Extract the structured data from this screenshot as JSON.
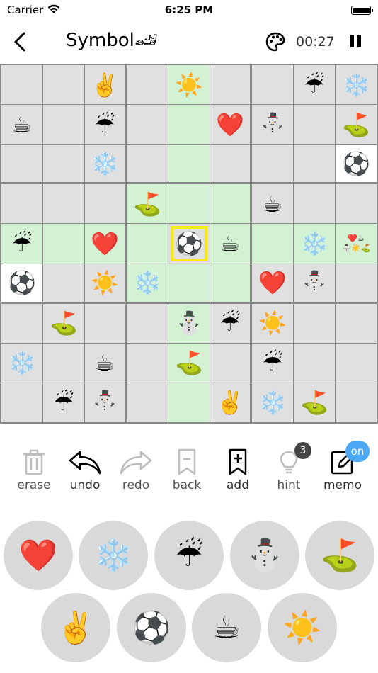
{
  "status": {
    "carrier": "Carrier",
    "time": "6:25 PM"
  },
  "nav": {
    "title": "Symbol🏎",
    "timer": "00:27"
  },
  "board": {
    "rows": [
      [
        "",
        "",
        "✌️",
        "",
        "☀️",
        "",
        "",
        "☔",
        "❄️"
      ],
      [
        "☕",
        "",
        "☔",
        "",
        "",
        "❤️",
        "⛄",
        "",
        "⛳"
      ],
      [
        "",
        "",
        "❄️",
        "",
        "",
        "",
        "",
        "",
        "⚽"
      ],
      [
        "",
        "",
        "",
        "⛳",
        "",
        "",
        "☕",
        "",
        ""
      ],
      [
        "☔",
        "",
        "❤️",
        "",
        "⚽",
        "☕",
        "",
        "❄️",
        ""
      ],
      [
        "⚽",
        "",
        "☀️",
        "❄️",
        "",
        "",
        "❤️",
        "⛄",
        ""
      ],
      [
        "",
        "⛳",
        "",
        "",
        "⛄",
        "☔",
        "☀️",
        "",
        ""
      ],
      [
        "❄️",
        "",
        "☕",
        "",
        "⛳",
        "",
        "☔",
        "",
        ""
      ],
      [
        "",
        "☔",
        "⛄",
        "",
        "",
        "✌️",
        "❄️",
        "⛳",
        ""
      ]
    ],
    "memo_cell": {
      "row": 4,
      "col": 8,
      "symbols": [
        "❤️",
        "☕",
        "⛄",
        "☀️",
        "⛳"
      ]
    }
  },
  "tools": [
    {
      "label": "erase",
      "icon": "trash-icon"
    },
    {
      "label": "undo",
      "icon": "undo-icon"
    },
    {
      "label": "redo",
      "icon": "redo-icon"
    },
    {
      "label": "back",
      "icon": "bookmark-back-icon"
    },
    {
      "label": "add",
      "icon": "bookmark-add-icon"
    },
    {
      "label": "hint",
      "icon": "lightbulb-icon",
      "badge": "3"
    },
    {
      "label": "memo",
      "icon": "memo-edit-icon",
      "badge": "on"
    }
  ],
  "symbols_row1": [
    "❤️",
    "❄️",
    "☔",
    "⛄",
    "⛳"
  ],
  "symbols_row2": [
    "✌️",
    "⚽",
    "☕",
    "☀️"
  ],
  "colors": {
    "highlight": "#d3f2d3",
    "cell": "#e0e0e0",
    "selected_border": "#f7ec0f",
    "badge_on": "#4aa8f5"
  }
}
